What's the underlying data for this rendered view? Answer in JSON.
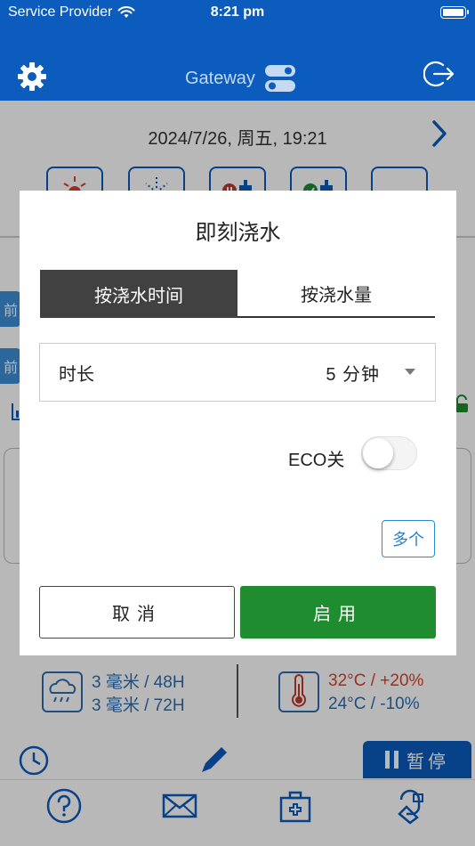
{
  "status_bar": {
    "carrier": "Service Provider",
    "time": "8:21 pm"
  },
  "header": {
    "title": "Gateway"
  },
  "page": {
    "date": "2024/7/26, 周五, 19:21",
    "side_tab_1": "前",
    "side_tab_2": "前",
    "rain_line_1": "3 毫米 / 48H",
    "rain_line_2": "3 毫米 / 72H",
    "temp_line_1": "32°C / +20%",
    "temp_line_2": "24°C / -10%",
    "pause_label": "暂停"
  },
  "dialog": {
    "title": "即刻浇水",
    "tab_time": "按浇水时间",
    "tab_volume": "按浇水量",
    "duration_label": "时长",
    "duration_value": "5 分钟",
    "eco_label": "ECO关",
    "eco_on": false,
    "multi_button": "多个",
    "cancel_button": "取消",
    "enable_button": "启用"
  },
  "colors": {
    "brand_blue": "#0b5cbd",
    "enable_green": "#1e8c2f",
    "active_tab": "#414141",
    "warm_red": "#d9452b",
    "cool_blue": "#2e6db0"
  },
  "icons": [
    "wifi-icon",
    "battery-icon",
    "gear-icon",
    "toggle-icon",
    "logout-icon",
    "chevron-right-icon",
    "sun-icon",
    "sprinkler-icon",
    "valve-stop-icon",
    "valve-go-icon",
    "rain-cloud-icon",
    "thermometer-icon",
    "clock-icon",
    "pencil-icon",
    "pause-icon",
    "help-icon",
    "mail-icon",
    "first-aid-icon",
    "support-icon",
    "lock-icon",
    "chart-icon"
  ]
}
